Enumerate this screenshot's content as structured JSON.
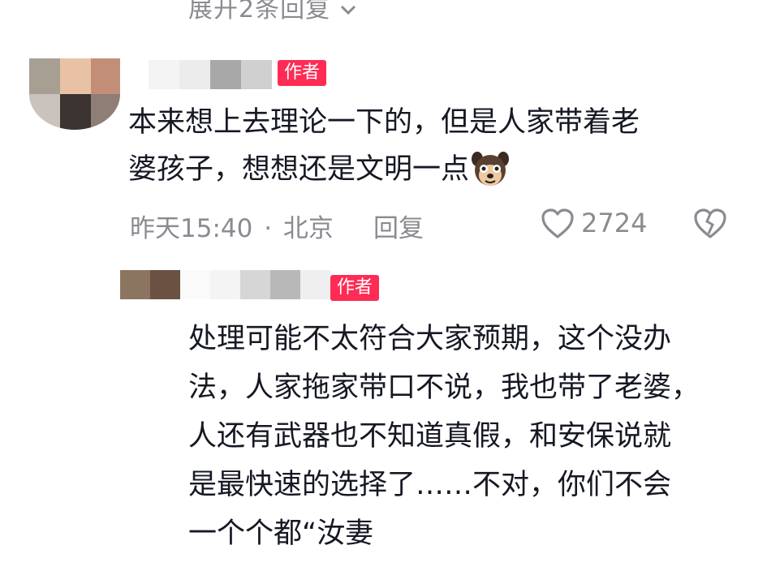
{
  "expand_replies": {
    "label": "展开2条回复"
  },
  "comment": {
    "author_badge": "作者",
    "text_lines": [
      "本来想上去理论一下的，但是人家带着老",
      "婆孩子，想想还是文明一点"
    ],
    "emoji_icon": "dog-face-sticker-icon",
    "time": "昨天15:40",
    "separator": "·",
    "location": "北京",
    "reply_label": "回复",
    "like_count": "2724",
    "icons": {
      "like": "heart-outline-icon",
      "dislike": "broken-heart-icon",
      "expand": "chevron-down-icon"
    }
  },
  "reply": {
    "author_badge": "作者",
    "text_lines": [
      "处理可能不太符合大家预期，这个没办",
      "法，人家拖家带口不说，我也带了老婆，",
      "人还有武器也不知道真假，和安保说就",
      "是最快速的选择了……不对，你们不会",
      "一个个都“汝妻"
    ]
  },
  "colors": {
    "text": "#161823",
    "meta": "#8a8b91",
    "badge": "#fe2c55"
  }
}
